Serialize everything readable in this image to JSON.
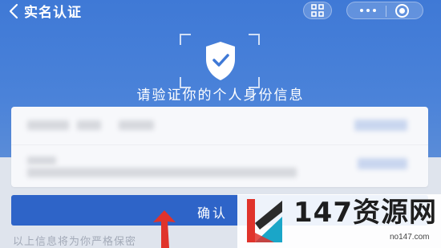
{
  "nav": {
    "back_label": "实名认证"
  },
  "icons": {
    "back": "chevron-left-icon",
    "scan": "scan-icon",
    "more": "more-dots-icon",
    "close": "close-circle-icon",
    "shield": "shield-check-icon"
  },
  "hero": {
    "subtitle": "请验证你的个人身份信息"
  },
  "actions": {
    "confirm_label": "确认"
  },
  "footer": {
    "note": "以上信息将为你严格保密"
  },
  "watermark": {
    "brand": "147资源网",
    "domain": "no147.com"
  },
  "colors": {
    "header": "#3f79d6",
    "button": "#2e64c8",
    "arrow": "#e0332b"
  }
}
